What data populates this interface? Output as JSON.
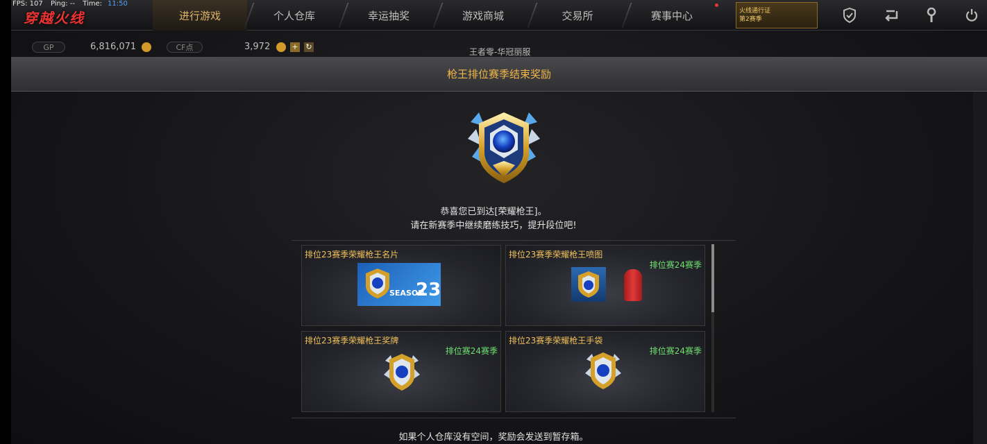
{
  "stats": {
    "fps": "FPS: 107",
    "ping": "Ping: --",
    "time_label": "Time:",
    "time": "11:50"
  },
  "logo": {
    "text": "穿越火线"
  },
  "tabs": [
    {
      "label": "进行游戏",
      "active": true
    },
    {
      "label": "个人仓库"
    },
    {
      "label": "幸运抽奖"
    },
    {
      "label": "游戏商城"
    },
    {
      "label": "交易所"
    },
    {
      "label": "赛事中心"
    }
  ],
  "badge": {
    "line1": "火线通行证",
    "line2": "第2赛季"
  },
  "icons": [
    "shield-icon",
    "return-icon",
    "wrench-icon",
    "power-icon"
  ],
  "currency": {
    "gp_label": "GP",
    "gp_value": "6,816,071",
    "cf_label": "CF点",
    "cf_value": "3,972"
  },
  "server": "王者零-华冠丽服",
  "dialog": {
    "title": "枪王排位赛季结束奖励",
    "line1": "恭喜您已到达[荣耀枪王]。",
    "line2": "请在新赛季中继续磨练技巧，提升段位吧!",
    "footer": "如果个人仓库没有空间，奖励会发送到暂存箱。"
  },
  "rewards": [
    {
      "name": "排位23赛季荣耀枪王名片",
      "season": "",
      "image": "season-card",
      "card_text": "SEASON",
      "card_num": "23"
    },
    {
      "name": "排位23赛季荣耀枪王喷图",
      "season": "排位赛24赛季",
      "image": "spray"
    },
    {
      "name": "排位23赛季荣耀枪王奖牌",
      "season": "排位赛24赛季",
      "image": "medal"
    },
    {
      "name": "排位23赛季荣耀枪王手袋",
      "season": "排位赛24赛季",
      "image": "medal"
    }
  ],
  "colors": {
    "title": "#f0b64a",
    "reward_name": "#f2c15a",
    "season": "#6fe06f",
    "time": "#4fa3ff"
  }
}
